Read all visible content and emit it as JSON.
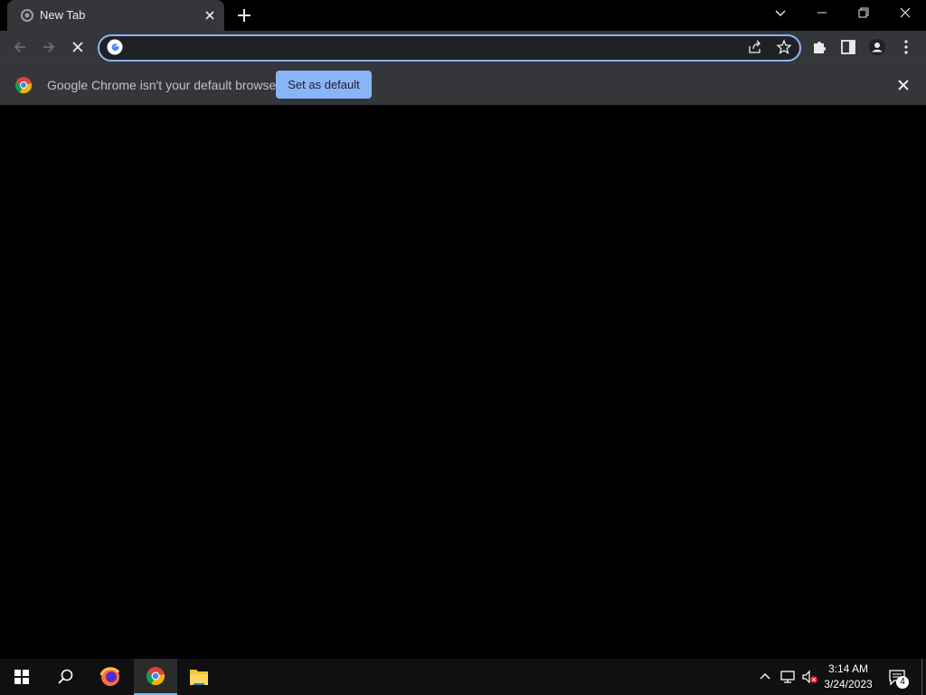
{
  "tab": {
    "title": "New Tab"
  },
  "omnibox": {
    "value": ""
  },
  "infobar": {
    "message": "Google Chrome isn't your default browser",
    "button_label": "Set as default"
  },
  "taskbar": {
    "time": "3:14 AM",
    "date": "3/24/2023",
    "notification_count": "4"
  },
  "colors": {
    "accent": "#8ab4f8",
    "toolbar": "#35363a",
    "frame": "#000000"
  }
}
